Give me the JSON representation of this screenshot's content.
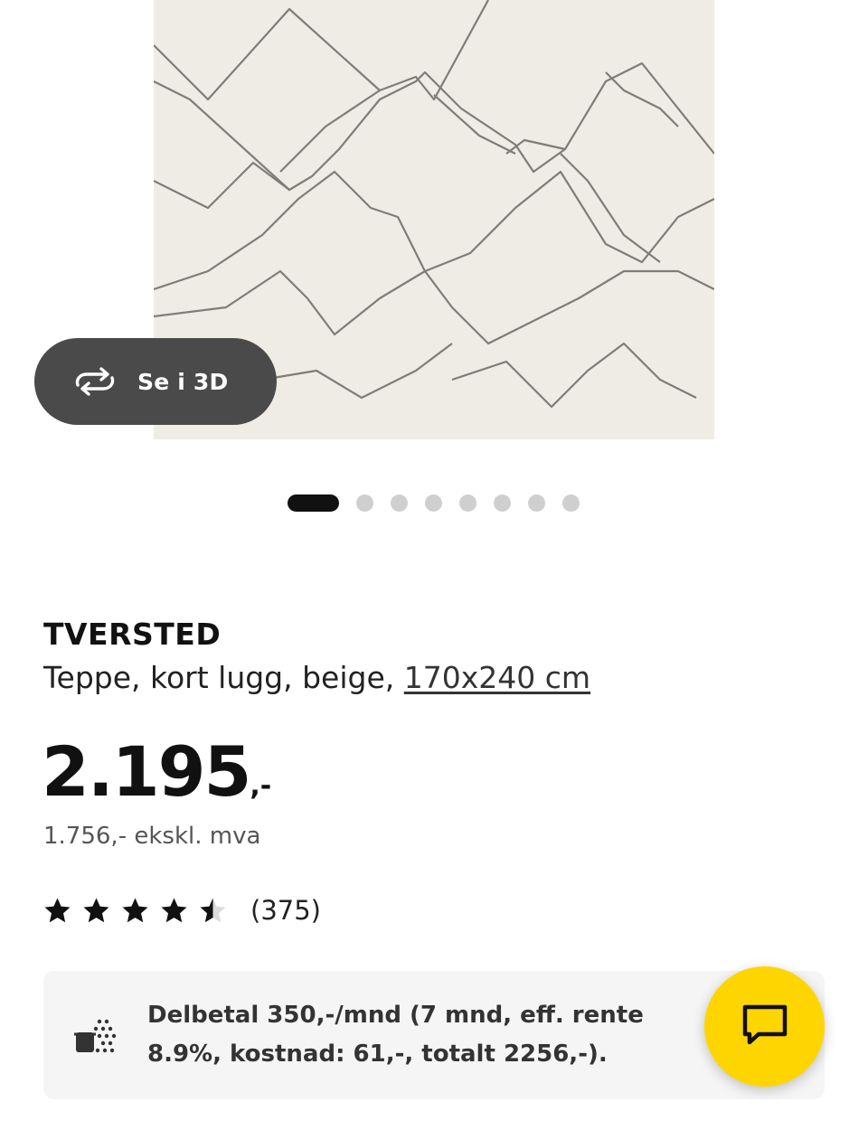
{
  "product": {
    "name": "TVERSTED",
    "description": "Teppe, kort lugg, beige, ",
    "size": "170x240 cm",
    "price_integer": "2.195",
    "price_suffix": ",-",
    "price_ex_vat": "1.756,- ekskl. mva",
    "rating_value": 4.5,
    "rating_max": 5,
    "review_count": "(375)"
  },
  "gallery": {
    "view_3d_label": "Se i 3D",
    "image_count": 8,
    "active_index": 0
  },
  "financing": {
    "text": "Delbetal 350,-/mnd (7 mnd, eff. rente 8.9%, kostnad: 61,-, totalt 2256,-)."
  },
  "icons": {
    "view_3d": "rotate-3d-icon",
    "star": "star-icon",
    "financing": "payment-icon",
    "chat": "chat-bubble-icon"
  },
  "colors": {
    "accent": "#ffd500",
    "text": "#111111",
    "button_dark": "#4a4a4a",
    "dot_inactive": "#cfcfcf",
    "panel": "#f5f5f5"
  }
}
